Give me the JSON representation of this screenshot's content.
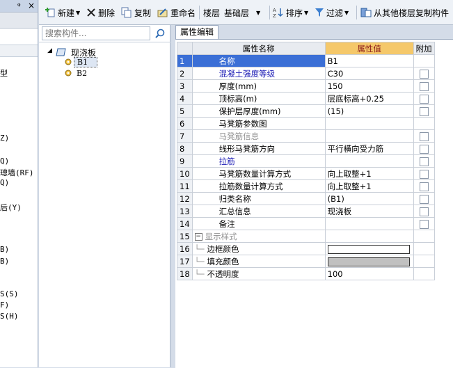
{
  "left_strip": {
    "pin": "ᵠ",
    "close": "×",
    "fragments": [
      "型",
      "Z)",
      "Q)",
      "璁墙(RF)",
      "Q)",
      "后(Y)",
      "B)",
      "B)",
      "S(S)",
      "F)",
      "S(H)"
    ]
  },
  "toolbar": {
    "new_label": "新建",
    "delete_label": "删除",
    "copy_label": "复制",
    "rename_label": "重命名",
    "floor_label": "楼层",
    "floor_value": "基础层",
    "sort_label": "排序",
    "filter_label": "过滤",
    "copy_from_floor_label": "从其他楼层复制构件"
  },
  "tree": {
    "search_placeholder": "搜索构件...",
    "root_label": "现浇板",
    "children": [
      "B1",
      "B2"
    ]
  },
  "property_panel": {
    "tab_label": "属性编辑",
    "col_name": "属性名称",
    "col_value": "属性值",
    "col_add": "附加",
    "rows": [
      {
        "num": "1",
        "name": "名称",
        "value": "B1",
        "style": "blue",
        "checkbox": false
      },
      {
        "num": "2",
        "name": "混凝土强度等级",
        "value": "C30",
        "style": "blue",
        "checkbox": true
      },
      {
        "num": "3",
        "name": "厚度(mm)",
        "value": "150",
        "style": "",
        "checkbox": true
      },
      {
        "num": "4",
        "name": "顶标高(m)",
        "value": "层底标高+0.25",
        "style": "",
        "checkbox": true
      },
      {
        "num": "5",
        "name": "保护层厚度(mm)",
        "value": "(15)",
        "style": "",
        "checkbox": true
      },
      {
        "num": "6",
        "name": "马凳筋参数图",
        "value": "",
        "style": "",
        "checkbox": false
      },
      {
        "num": "7",
        "name": "马凳筋信息",
        "value": "",
        "style": "gray",
        "checkbox": true
      },
      {
        "num": "8",
        "name": "线形马凳筋方向",
        "value": "平行横向受力筋",
        "style": "",
        "checkbox": true
      },
      {
        "num": "9",
        "name": "拉筋",
        "value": "",
        "style": "blue",
        "checkbox": true
      },
      {
        "num": "10",
        "name": "马凳筋数量计算方式",
        "value": "向上取整+1",
        "style": "",
        "checkbox": true
      },
      {
        "num": "11",
        "name": "拉筋数量计算方式",
        "value": "向上取整+1",
        "style": "",
        "checkbox": true
      },
      {
        "num": "12",
        "name": "归类名称",
        "value": "(B1)",
        "style": "",
        "checkbox": true
      },
      {
        "num": "13",
        "name": "汇总信息",
        "value": "现浇板",
        "style": "",
        "checkbox": true
      },
      {
        "num": "14",
        "name": "备注",
        "value": "",
        "style": "",
        "checkbox": true
      }
    ],
    "display_group": {
      "num": "15",
      "label": "显示样式",
      "rows": [
        {
          "num": "16",
          "name": "边框颜色",
          "color": "#ffffff"
        },
        {
          "num": "17",
          "name": "填充颜色",
          "color": "#c0c0c0"
        },
        {
          "num": "18",
          "name": "不透明度",
          "value": "100"
        }
      ]
    }
  },
  "colors": {
    "header_value_bg": "#f5c86a",
    "selected_row_bg": "#3b6fd6",
    "link_blue": "#1a1ab4"
  }
}
